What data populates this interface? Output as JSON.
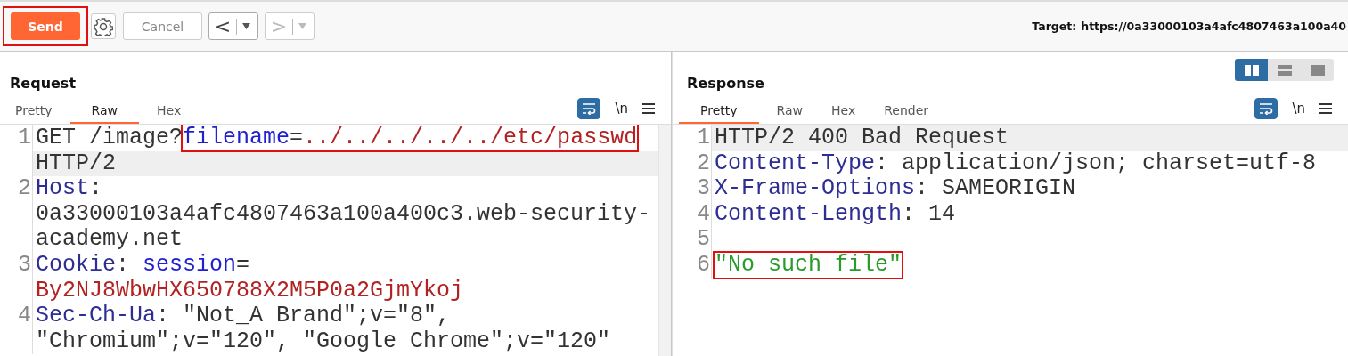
{
  "toolbar": {
    "send": {
      "label": "Send",
      "boxed": true
    },
    "cancel": {
      "label": "Cancel",
      "disabled": true
    },
    "history": [
      {
        "glyph": "<",
        "disabled": false
      },
      {
        "glyph": ">",
        "disabled": true
      }
    ],
    "target": {
      "label": "Target:",
      "url": "https://0a33000103a4afc4807463a100a40"
    }
  },
  "layout_toggle": [
    {
      "kind": "columns",
      "selected": true
    },
    {
      "kind": "rows",
      "selected": false
    },
    {
      "kind": "single",
      "selected": false
    }
  ],
  "panes": [
    {
      "title": "Request",
      "tabs": [
        {
          "label": "Pretty",
          "selected": false
        },
        {
          "label": "Raw",
          "selected": true
        },
        {
          "label": "Hex",
          "selected": false
        }
      ],
      "wrap_on": true,
      "newline_label": "\\n",
      "lines": [
        {
          "number": "1",
          "rows": [
            {
              "highlighted": false,
              "segments": [
                {
                  "kind": "text",
                  "text": "GET /image?"
                },
                {
                  "kind": "param",
                  "text": "filename",
                  "boxed": true
                },
                {
                  "kind": "text",
                  "text": "=",
                  "boxed": true
                },
                {
                  "kind": "value",
                  "text": "../../../../../etc/passwd",
                  "boxed": true
                }
              ]
            },
            {
              "highlighted": true,
              "segments": [
                {
                  "kind": "text",
                  "text": "HTTP/2"
                }
              ]
            }
          ]
        },
        {
          "number": "2",
          "rows": [
            {
              "highlighted": false,
              "segments": [
                {
                  "kind": "name",
                  "text": "Host"
                },
                {
                  "kind": "text",
                  "text": ":"
                }
              ]
            },
            {
              "highlighted": false,
              "segments": [
                {
                  "kind": "text",
                  "text": "0a33000103a4afc4807463a100a400c3.web-security-"
                }
              ]
            },
            {
              "highlighted": false,
              "segments": [
                {
                  "kind": "text",
                  "text": "academy.net"
                }
              ]
            }
          ]
        },
        {
          "number": "3",
          "rows": [
            {
              "highlighted": false,
              "segments": [
                {
                  "kind": "name",
                  "text": "Cookie"
                },
                {
                  "kind": "text",
                  "text": ": "
                },
                {
                  "kind": "param",
                  "text": "session"
                },
                {
                  "kind": "text",
                  "text": "="
                }
              ]
            },
            {
              "highlighted": false,
              "segments": [
                {
                  "kind": "value",
                  "text": "By2NJ8WbwHX650788X2M5P0a2GjmYkoj"
                }
              ]
            }
          ]
        },
        {
          "number": "4",
          "rows": [
            {
              "highlighted": false,
              "segments": [
                {
                  "kind": "name",
                  "text": "Sec-Ch-Ua"
                },
                {
                  "kind": "text",
                  "text": ": \"Not_A Brand\";v=\"8\","
                }
              ]
            },
            {
              "highlighted": false,
              "segments": [
                {
                  "kind": "text",
                  "text": "\"Chromium\";v=\"120\", \"Google Chrome\";v=\"120\""
                }
              ]
            }
          ]
        }
      ]
    },
    {
      "title": "Response",
      "tabs": [
        {
          "label": "Pretty",
          "selected": true
        },
        {
          "label": "Raw",
          "selected": false
        },
        {
          "label": "Hex",
          "selected": false
        },
        {
          "label": "Render",
          "selected": false
        }
      ],
      "wrap_on": true,
      "newline_label": "\\n",
      "lines": [
        {
          "number": "1",
          "rows": [
            {
              "highlighted": true,
              "segments": [
                {
                  "kind": "text",
                  "text": "HTTP/2 400 Bad Request"
                }
              ]
            }
          ]
        },
        {
          "number": "2",
          "rows": [
            {
              "highlighted": false,
              "segments": [
                {
                  "kind": "name",
                  "text": "Content-Type"
                },
                {
                  "kind": "text",
                  "text": ": application/json; charset=utf-8"
                }
              ]
            }
          ]
        },
        {
          "number": "3",
          "rows": [
            {
              "highlighted": false,
              "segments": [
                {
                  "kind": "name",
                  "text": "X-Frame-Options"
                },
                {
                  "kind": "text",
                  "text": ": SAMEORIGIN"
                }
              ]
            }
          ]
        },
        {
          "number": "4",
          "rows": [
            {
              "highlighted": false,
              "segments": [
                {
                  "kind": "name",
                  "text": "Content-Length"
                },
                {
                  "kind": "text",
                  "text": ": 14"
                }
              ]
            }
          ]
        },
        {
          "number": "5",
          "rows": [
            {
              "highlighted": false,
              "segments": []
            }
          ]
        },
        {
          "number": "6",
          "rows": [
            {
              "highlighted": false,
              "segments": [
                {
                  "kind": "string",
                  "text": "\"No such file\"",
                  "boxed": true
                }
              ]
            }
          ]
        }
      ]
    }
  ]
}
